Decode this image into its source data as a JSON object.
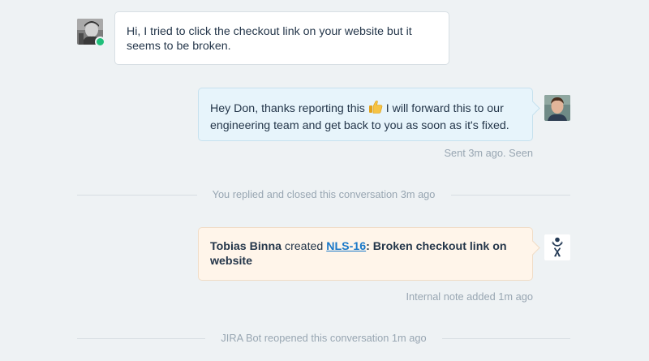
{
  "messages": {
    "customer": {
      "text": "Hi, I tried to click the checkout link on your website but it seems to be broken."
    },
    "agent": {
      "text_before_emoji": "Hey Don, thanks reporting this ",
      "emoji": "👍",
      "text_after_emoji": " I will forward this to our engineering team and get back to you as soon as it's fixed.",
      "status": "Sent 3m ago. Seen"
    }
  },
  "dividers": {
    "closed": "You replied and closed this conversation 3m ago",
    "reopened": "JIRA Bot reopened this conversation 1m ago"
  },
  "note": {
    "author": "Tobias Binna",
    "action": " created ",
    "issue_key": "NLS-16",
    "issue_title": ": Broken checkout link on website",
    "status": "Internal note added 1m ago"
  },
  "colors": {
    "online": "#1fbf7a",
    "link": "#1a78c8",
    "background": "#eef2f4"
  }
}
